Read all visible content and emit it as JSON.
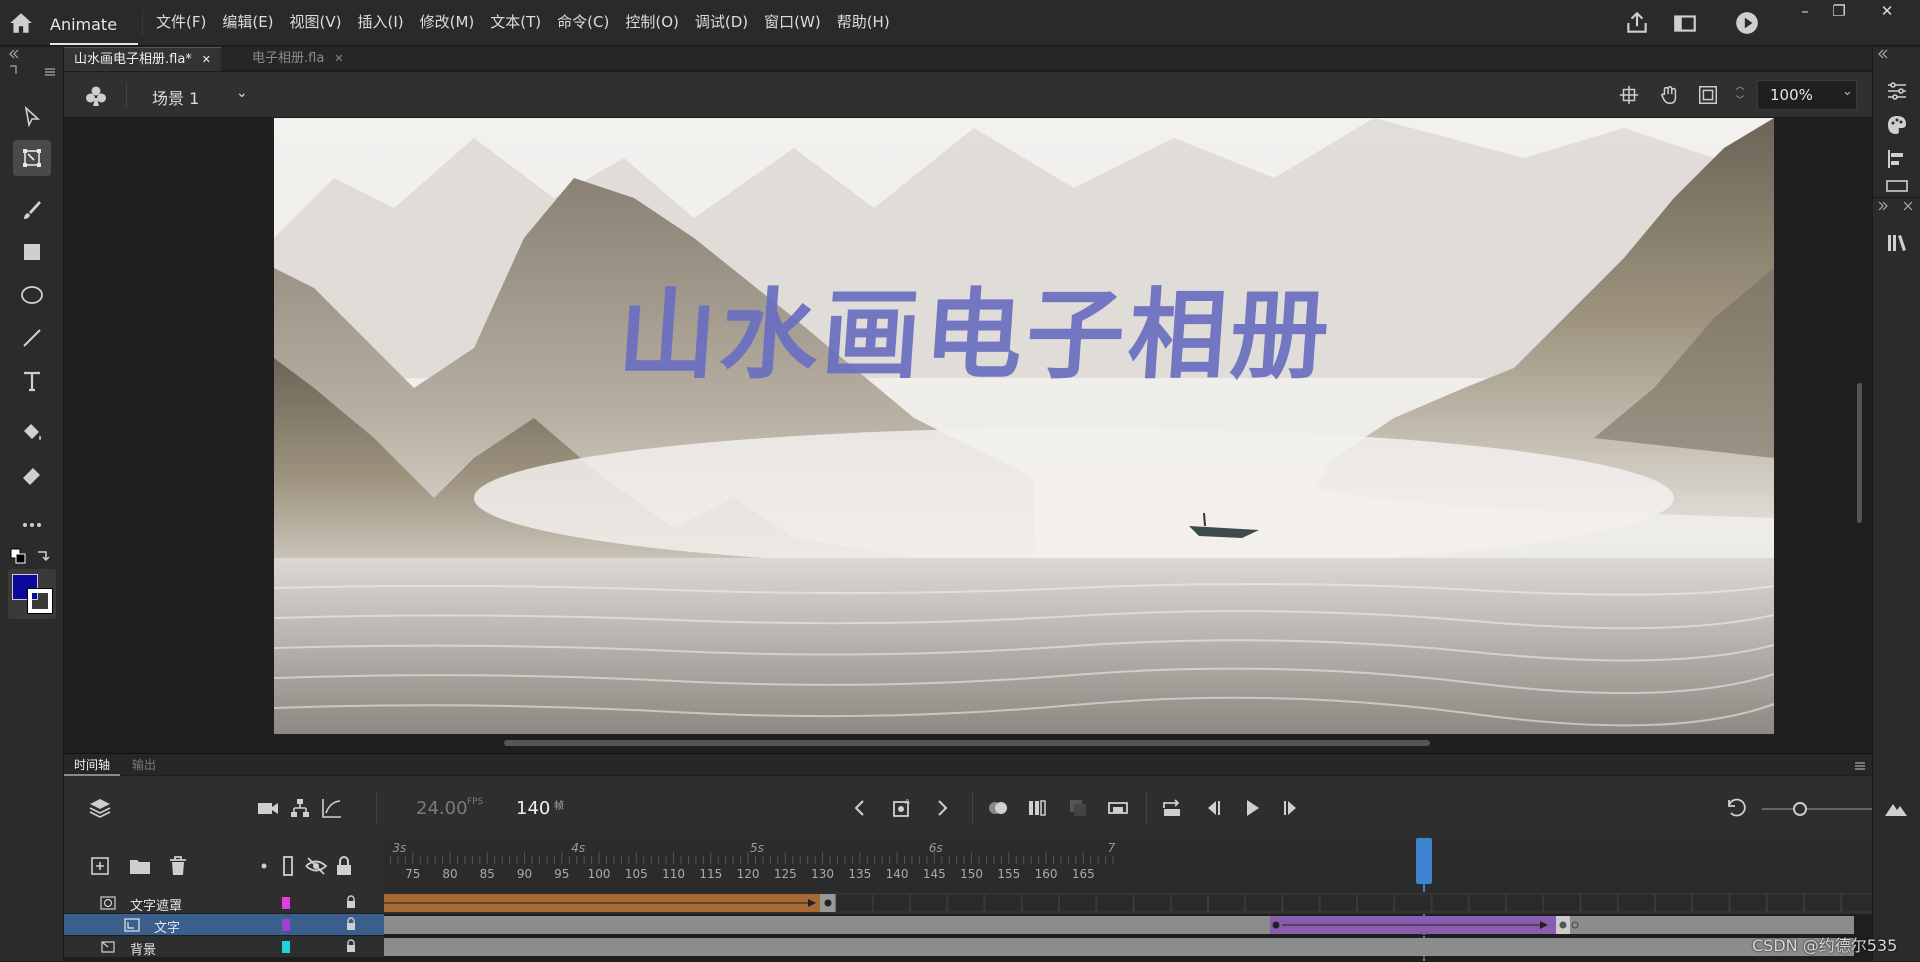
{
  "app": {
    "name": "Animate",
    "menus": [
      "文件(F)",
      "编辑(E)",
      "视图(V)",
      "插入(I)",
      "修改(M)",
      "文本(T)",
      "命令(C)",
      "控制(O)",
      "调试(D)",
      "窗口(W)",
      "帮助(H)"
    ]
  },
  "window_controls": {
    "minimize": "–",
    "restore": "❐",
    "close": "✕"
  },
  "doc_tabs": [
    {
      "label": "山水画电子相册.fla*",
      "active": true
    },
    {
      "label": "电子相册.fla",
      "active": false
    }
  ],
  "scene": {
    "name": "场景 1",
    "dropdown": "⌄"
  },
  "zoom": {
    "value": "100%",
    "dropdown": "⌄",
    "spin": "︿\n﹀"
  },
  "stage": {
    "title_text": "山水画电子相册",
    "title_color": "#6a6ec0",
    "fill_color": "#0a0a9a"
  },
  "timeline": {
    "tabs": [
      {
        "label": "时间轴",
        "active": true
      },
      {
        "label": "输出",
        "active": false
      }
    ],
    "fps": "24.00",
    "fps_unit": "FPS",
    "current_frame": "140",
    "frame_unit": "帧",
    "second_labels": [
      "3s",
      "4s",
      "5s",
      "6s",
      "7"
    ],
    "frame_labels": [
      "75",
      "80",
      "85",
      "90",
      "95",
      "100",
      "105",
      "110",
      "115",
      "120",
      "125",
      "130",
      "135",
      "140",
      "145",
      "150",
      "155",
      "160",
      "165"
    ],
    "layers": [
      {
        "name": "文字遮罩",
        "color": "#e040e0",
        "selected": false
      },
      {
        "name": "文字",
        "color": "#a040d0",
        "selected": true
      },
      {
        "name": "背景",
        "color": "#20d0e0",
        "selected": false
      }
    ],
    "colors": {
      "classic_tween": "#a66a35",
      "motion_tween": "#8a5cb0",
      "playhead": "#3b82d0"
    }
  },
  "watermark": "CSDN @约德尔535"
}
